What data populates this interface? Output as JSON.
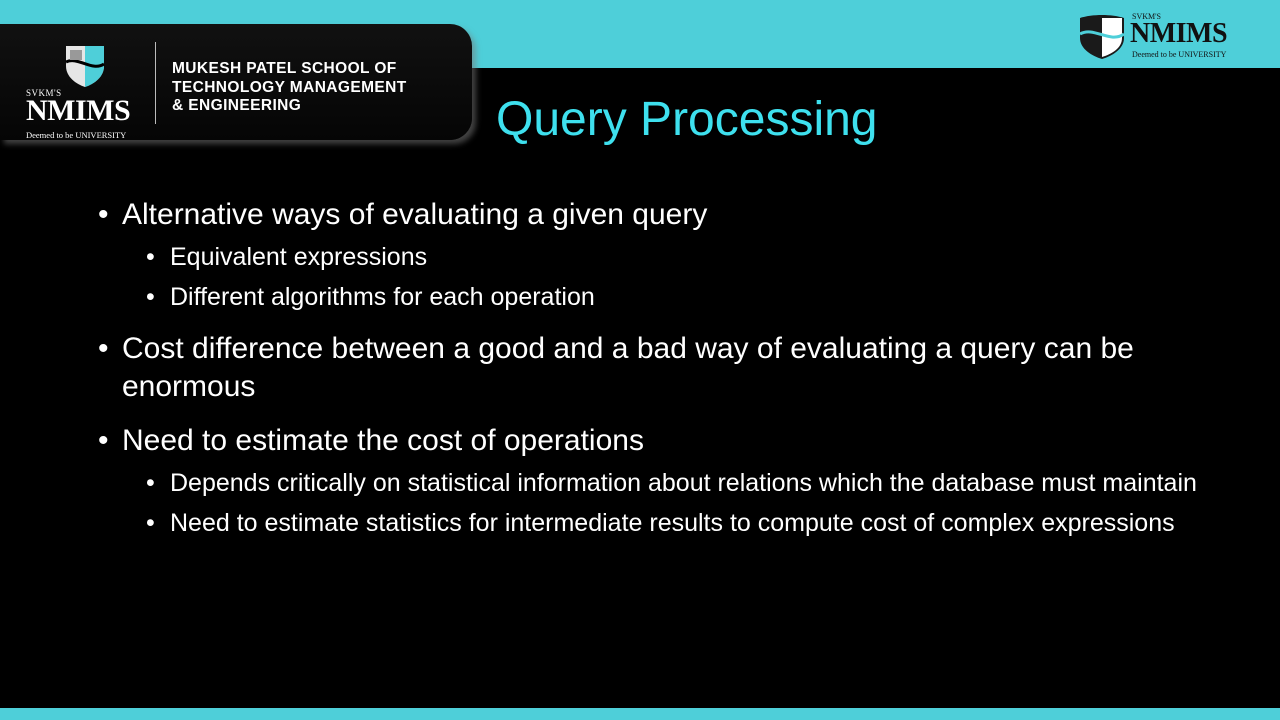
{
  "header": {
    "school_lines": [
      "MUKESH PATEL SCHOOL OF",
      "TECHNOLOGY MANAGEMENT",
      "& ENGINEERING"
    ],
    "logo_left": {
      "prefix": "SVKM'S",
      "name": "NMIMS",
      "tagline": "Deemed to be UNIVERSITY"
    },
    "logo_right": {
      "prefix": "SVKM'S",
      "name": "NMIMS",
      "tagline": "Deemed to be UNIVERSITY"
    }
  },
  "slide": {
    "title": "Query Processing",
    "bullets": [
      {
        "text": "Alternative ways of evaluating a given query",
        "sub": [
          "Equivalent expressions",
          "Different algorithms for each operation"
        ]
      },
      {
        "text": "Cost difference between a good and a bad way of evaluating a query can be enormous",
        "sub": []
      },
      {
        "text": "Need to estimate the cost of operations",
        "sub": [
          "Depends critically on statistical information about relations which the database must maintain",
          "Need to estimate statistics for intermediate results to compute cost of complex expressions"
        ]
      }
    ]
  },
  "colors": {
    "accent": "#4ecfd9",
    "title": "#3ee0ee",
    "background": "#000000"
  },
  "icons": {
    "bullet": "•"
  }
}
